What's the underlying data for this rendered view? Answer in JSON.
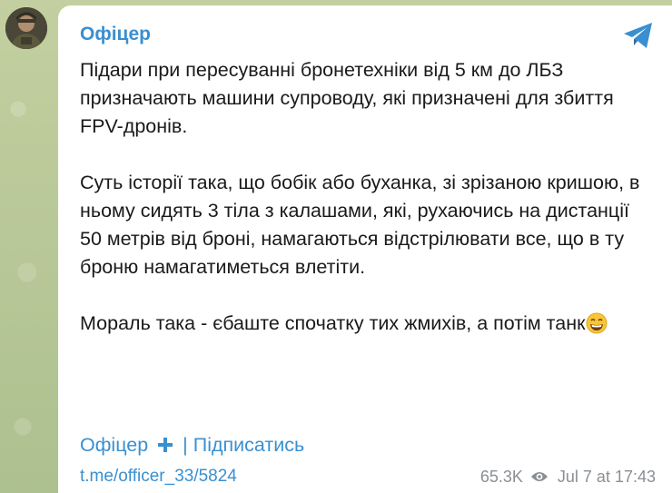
{
  "channel": {
    "name": "Офіцер",
    "avatar_icon": "soldier-avatar",
    "platform_icon": "telegram-icon",
    "accent_color": "#3a8fd0"
  },
  "post": {
    "paragraphs": [
      "Підари при пересуванні бронетехніки від 5 км до ЛБЗ призначають машини супроводу, які призначені для збиття FPV-дронів.",
      "Суть історії така, що бобік або буханка, зі зрізаною кришою, в ньому сидять 3 тіла з калашами, які, рухаючись на дистанції 50 метрів від броні, намагаються відстрілювати все, що в ту броню намагатиметься влетіти.",
      "Мораль така - єбаште спочатку тих жмихів, а потім танк"
    ],
    "emoji": "grinning-face-with-smiling-eyes"
  },
  "footer": {
    "channel_link": "Офіцер",
    "separator": "|",
    "subscribe_link": "Підписатись",
    "post_url": "t.me/officer_33/5824",
    "views": "65.3K",
    "date": "Jul 7 at 17:43"
  }
}
